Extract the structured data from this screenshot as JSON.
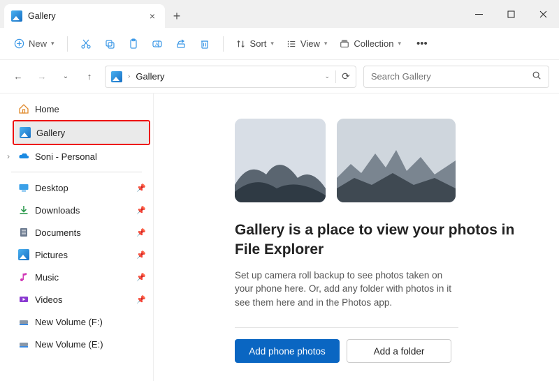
{
  "window": {
    "tab_title": "Gallery"
  },
  "toolbar": {
    "new_label": "New",
    "sort_label": "Sort",
    "view_label": "View",
    "collection_label": "Collection"
  },
  "address": {
    "crumb": "Gallery",
    "search_placeholder": "Search Gallery"
  },
  "sidebar": {
    "home": "Home",
    "gallery": "Gallery",
    "onedrive": "Soni - Personal",
    "desktop": "Desktop",
    "downloads": "Downloads",
    "documents": "Documents",
    "pictures": "Pictures",
    "music": "Music",
    "videos": "Videos",
    "vol_f": "New Volume (F:)",
    "vol_e": "New Volume (E:)"
  },
  "empty": {
    "title": "Gallery is a place to view your photos in File Explorer",
    "desc": "Set up camera roll backup to see photos taken on your phone here. Or, add any folder with photos in it see them here and in the Photos app.",
    "primary_btn": "Add phone photos",
    "secondary_btn": "Add a folder"
  }
}
